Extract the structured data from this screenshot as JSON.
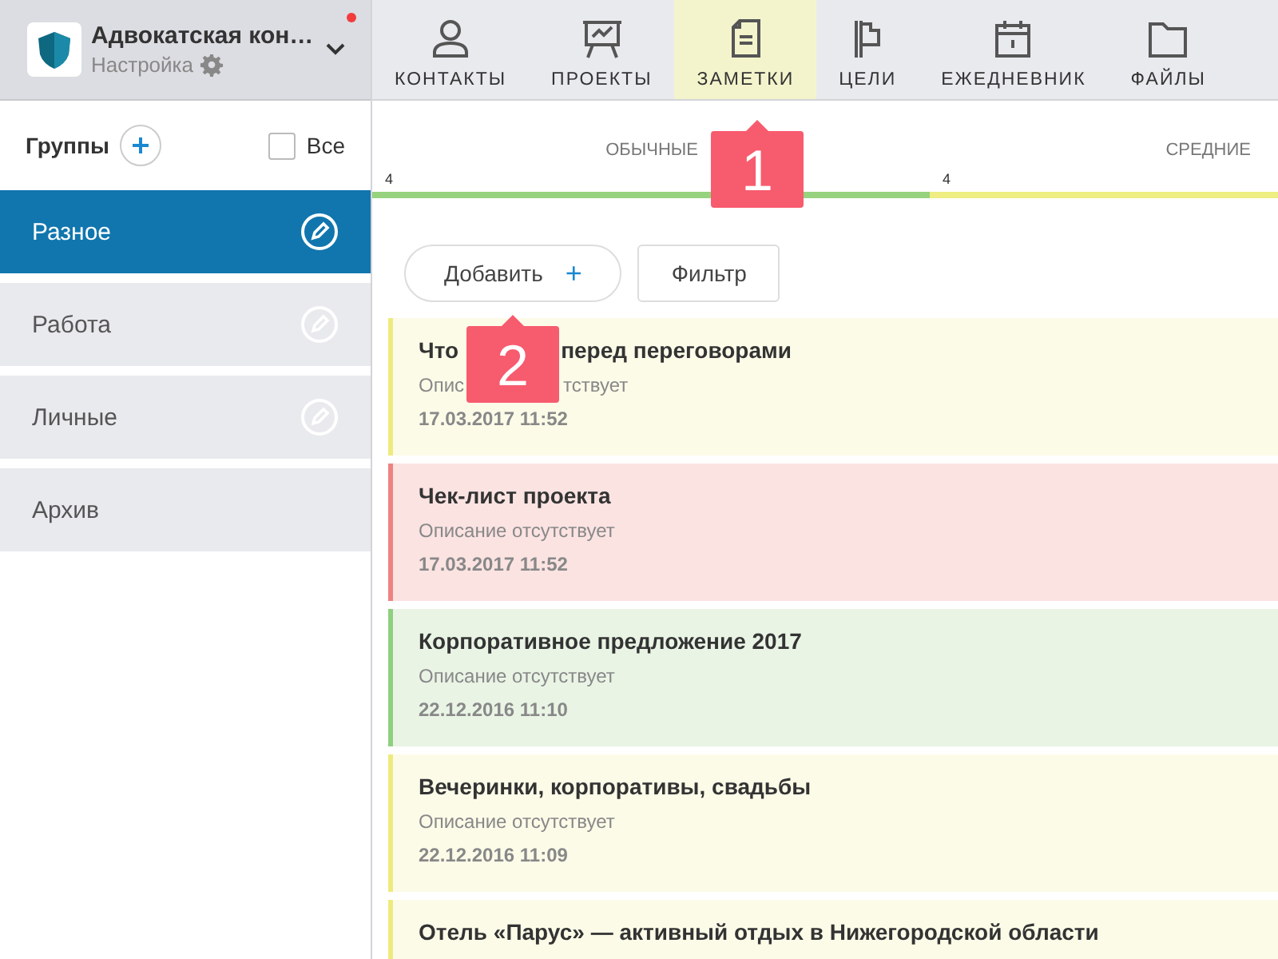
{
  "account": {
    "name": "Адвокатская кон…",
    "subtitle": "Настройка",
    "notification": true
  },
  "nav": [
    {
      "label": "КОНТАКТЫ",
      "selected": false
    },
    {
      "label": "ПРОЕКТЫ",
      "selected": false
    },
    {
      "label": "ЗАМЕТКИ",
      "selected": true
    },
    {
      "label": "ЦЕЛИ",
      "selected": false
    },
    {
      "label": "ЕЖЕДНЕВНИК",
      "selected": false
    },
    {
      "label": "ФАЙЛЫ",
      "selected": false
    }
  ],
  "sidebar": {
    "title": "Группы",
    "all_label": "Все",
    "all_checked": false,
    "items": [
      {
        "label": "Разное",
        "selected": true,
        "editable": true
      },
      {
        "label": "Работа",
        "selected": false,
        "editable": true
      },
      {
        "label": "Личные",
        "selected": false,
        "editable": true
      },
      {
        "label": "Архив",
        "selected": false,
        "editable": false
      }
    ]
  },
  "priorities": [
    {
      "label": "ОБЫЧНЫЕ",
      "count": "4",
      "color": "#97d27f"
    },
    {
      "label": "СРЕДНИЕ",
      "count": "4",
      "color": "#eeee82"
    }
  ],
  "buttons": {
    "add": "Добавить",
    "add_icon": "+",
    "filter": "Фильтр"
  },
  "notes": [
    {
      "title_parts": [
        "Что",
        "перед переговорами"
      ],
      "description_parts": [
        "Опис",
        "тствует"
      ],
      "date": "17.03.2017 11:52",
      "color": "#eeea7e"
    },
    {
      "title_parts": [
        "Чек-лист проекта"
      ],
      "description_parts": [
        "Описание отсутствует"
      ],
      "date": "17.03.2017 11:52",
      "color": "#ee8282"
    },
    {
      "title_parts": [
        "Корпоративное предложение 2017"
      ],
      "description_parts": [
        "Описание отсутствует"
      ],
      "date": "22.12.2016 11:10",
      "color": "#8fcf7f"
    },
    {
      "title_parts": [
        "Вечеринки, корпоративы, свадьбы"
      ],
      "description_parts": [
        "Описание отсутствует"
      ],
      "date": "22.12.2016 11:09",
      "color": "#eeea7e"
    },
    {
      "title_parts": [
        "Отель «Парус» — активный отдых в Нижегородской области"
      ],
      "color": "#eeea7e"
    }
  ],
  "callouts": [
    {
      "number": "1"
    },
    {
      "number": "2"
    }
  ]
}
